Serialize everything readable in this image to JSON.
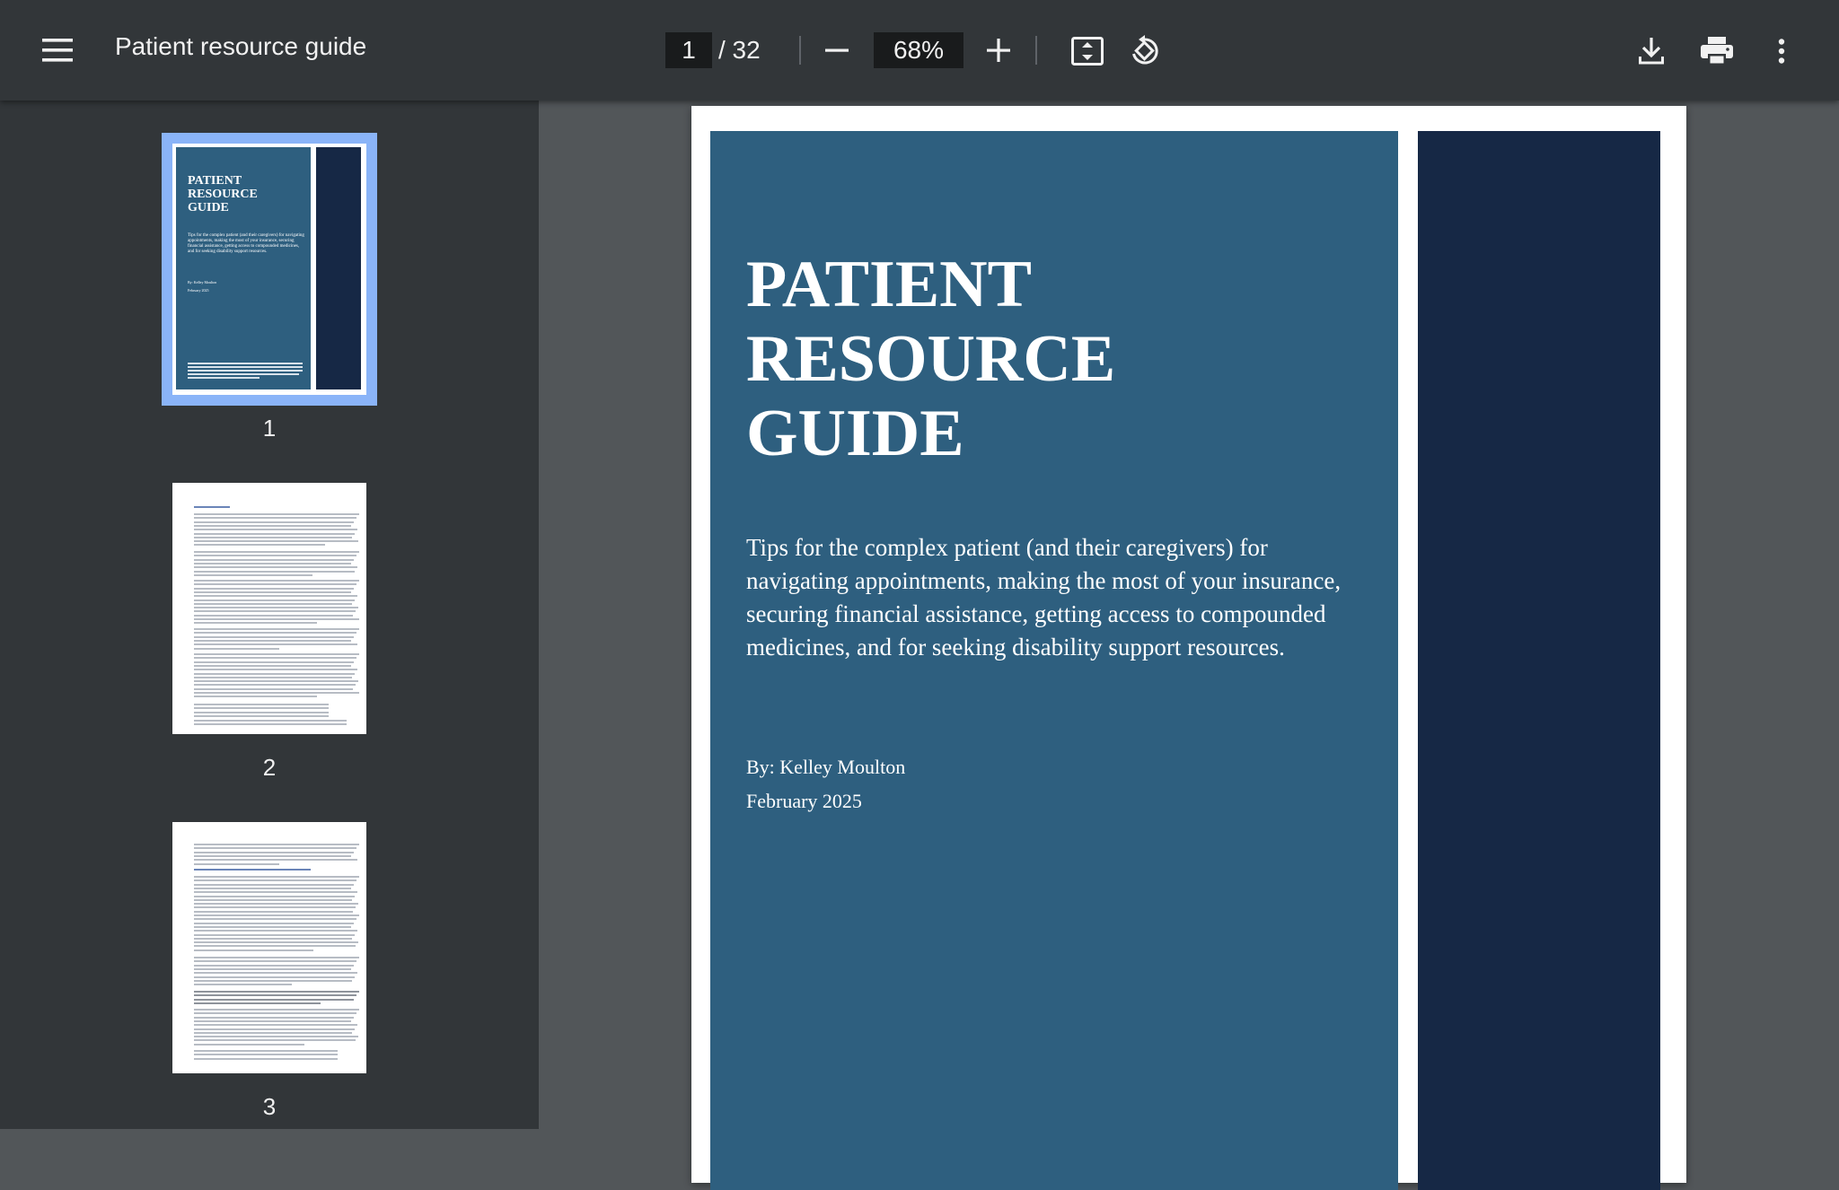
{
  "toolbar": {
    "title": "Patient resource guide",
    "current_page": "1",
    "total_pages": "/ 32",
    "zoom": "68%"
  },
  "sidebar": {
    "thumbnails": [
      {
        "number": "1",
        "selected": true
      },
      {
        "number": "2",
        "selected": false
      },
      {
        "number": "3",
        "selected": false
      }
    ]
  },
  "document": {
    "cover": {
      "title_line1": "PATIENT",
      "title_line2": "RESOURCE",
      "title_line3": "GUIDE",
      "subtitle": "Tips for the complex patient (and their caregivers) for navigating appointments, making the most of your insurance, securing financial assistance, getting access to compounded medicines, and for seeking disability support resources.",
      "author": "By: Kelley Moulton",
      "date": "February 2025"
    }
  },
  "colors": {
    "toolbar_bg": "#323639",
    "viewer_bg": "#525659",
    "cover_blue": "#2e5f7f",
    "cover_navy": "#162845",
    "selection": "#8ab4f8"
  },
  "icons": [
    "menu-icon",
    "minus-icon",
    "plus-icon",
    "fit-page-icon",
    "rotate-icon",
    "download-icon",
    "print-icon",
    "more-vert-icon"
  ]
}
